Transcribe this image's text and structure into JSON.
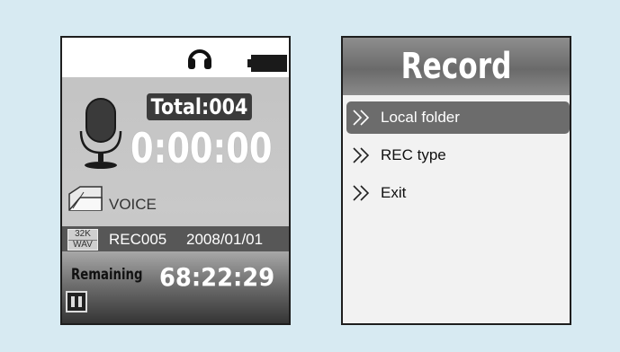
{
  "recorder": {
    "total_label": "Total:004",
    "elapsed_time": "0:00:00",
    "folder_label": "VOICE",
    "format": {
      "bitrate": "32K",
      "type": "WAV"
    },
    "file_name": "REC005",
    "file_date": "2008/01/01",
    "remaining_label": "Remaining",
    "remaining_time": "68:22:29",
    "battery_level": 1.0
  },
  "menu": {
    "title": "Record",
    "items": [
      {
        "label": "Local folder",
        "selected": true
      },
      {
        "label": "REC type",
        "selected": false
      },
      {
        "label": "Exit",
        "selected": false
      }
    ]
  },
  "colors": {
    "background": "#d7eaf2",
    "selection": "#6c6c6c"
  }
}
